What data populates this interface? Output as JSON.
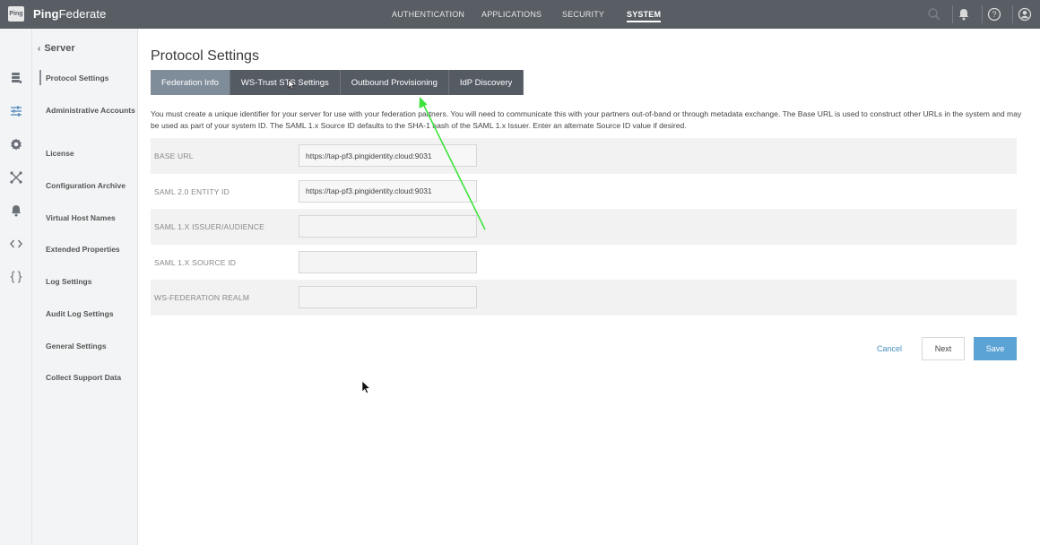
{
  "brand": {
    "logo_text": "Ping",
    "name_bold": "Ping",
    "name_rest": "Federate"
  },
  "top_nav": [
    {
      "label": "AUTHENTICATION"
    },
    {
      "label": "APPLICATIONS"
    },
    {
      "label": "SECURITY"
    },
    {
      "label": "SYSTEM",
      "active": true
    }
  ],
  "top_icons": [
    "search-icon",
    "bell-icon",
    "help-icon",
    "user-icon"
  ],
  "rail_icons": [
    "database-icon",
    "sliders-icon",
    "gear-icon",
    "network-icon",
    "bell-icon",
    "code-icon",
    "braces-icon"
  ],
  "sidebar": {
    "back_label": "Server",
    "items": [
      {
        "label": "Protocol Settings",
        "active": true
      },
      {
        "label": "Administrative Accounts"
      },
      {
        "label": "License"
      },
      {
        "label": "Configuration Archive"
      },
      {
        "label": "Virtual Host Names"
      },
      {
        "label": "Extended Properties"
      },
      {
        "label": "Log Settings"
      },
      {
        "label": "Audit Log Settings"
      },
      {
        "label": "General Settings"
      },
      {
        "label": "Collect Support Data"
      }
    ]
  },
  "main": {
    "title": "Protocol Settings",
    "tabs": [
      {
        "label": "Federation Info",
        "active": true
      },
      {
        "label": "WS-Trust STS Settings"
      },
      {
        "label": "Outbound Provisioning"
      },
      {
        "label": "IdP Discovery"
      }
    ],
    "description": "You must create a unique identifier for your server for use with your federation partners. You will need to communicate this with your partners out-of-band or through metadata exchange. The Base URL is used to construct other URLs in the system and may be used as part of your system ID. The SAML 1.x Source ID defaults to the SHA-1 hash of the SAML 1.x Issuer. Enter an alternate Source ID value if desired.",
    "fields": [
      {
        "label": "BASE URL",
        "value": "https://tap-pf3.pingidentity.cloud:9031"
      },
      {
        "label": "SAML 2.0 ENTITY ID",
        "value": "https://tap-pf3.pingidentity.cloud:9031"
      },
      {
        "label": "SAML 1.X ISSUER/AUDIENCE",
        "value": ""
      },
      {
        "label": "SAML 1.X SOURCE ID",
        "value": ""
      },
      {
        "label": "WS-FEDERATION REALM",
        "value": ""
      }
    ],
    "buttons": {
      "cancel": "Cancel",
      "next": "Next",
      "save": "Save"
    }
  },
  "colors": {
    "topbar": "#595e64",
    "tab_bg": "#555b63",
    "tab_active": "#7f8c9a",
    "save_button": "#5ba3d4",
    "cancel_link": "#4a90c2",
    "annotation_arrow": "#3ee23e"
  }
}
